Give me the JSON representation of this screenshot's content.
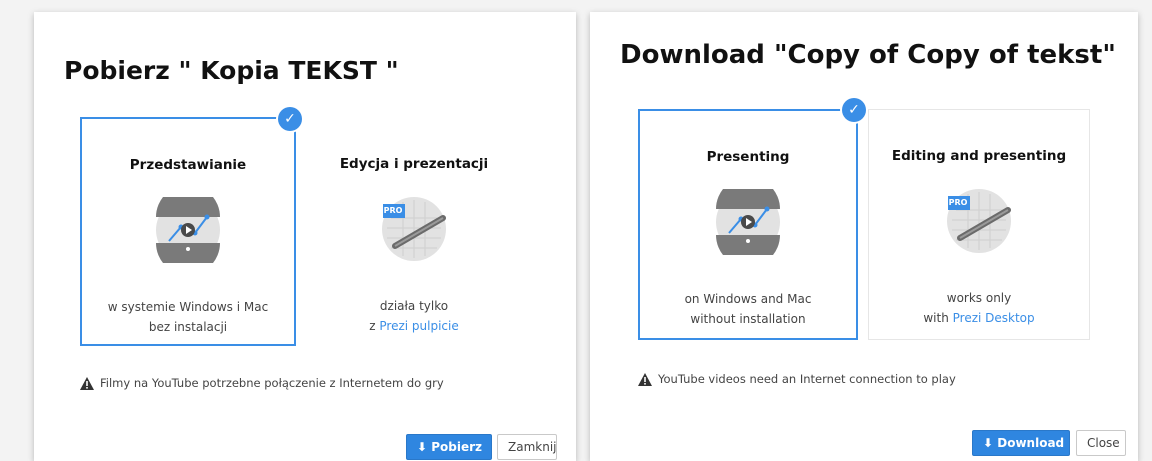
{
  "dialogs": [
    {
      "title": "Pobierz \" Kopia TEKST \"",
      "options": [
        {
          "title": "Przedstawianie",
          "desc_line1": "w systemie Windows i Mac",
          "desc_line2": "bez instalacji",
          "selected": true
        },
        {
          "title": "Edycja i prezentacji",
          "desc_line1": "działa tylko",
          "desc_line2_prefix": "z ",
          "desc_line2_link": "Prezi pulpicie",
          "badge": "PRO",
          "selected": false
        }
      ],
      "notice": "Filmy na YouTube potrzebne połączenie z Internetem do gry",
      "primary_button": "Pobierz",
      "secondary_button": "Zamknij"
    },
    {
      "title": "Download \"Copy of Copy of tekst\"",
      "options": [
        {
          "title": "Presenting",
          "desc_line1": "on Windows and Mac",
          "desc_line2": "without installation",
          "selected": true
        },
        {
          "title": "Editing and presenting",
          "desc_line1": "works only",
          "desc_line2_prefix": "with ",
          "desc_line2_link": "Prezi Desktop",
          "badge": "PRO",
          "selected": false
        }
      ],
      "notice": "YouTube videos need an Internet connection to play",
      "primary_button": "Download",
      "secondary_button": "Close"
    }
  ],
  "icons": {
    "check": "✓",
    "download": "⬇",
    "warning": "warning-triangle-icon"
  },
  "colors": {
    "accent": "#3a8ee6",
    "primary_button": "#2f86e0",
    "art_circle": "#e2e2e2",
    "art_band": "#7a7a7a"
  }
}
